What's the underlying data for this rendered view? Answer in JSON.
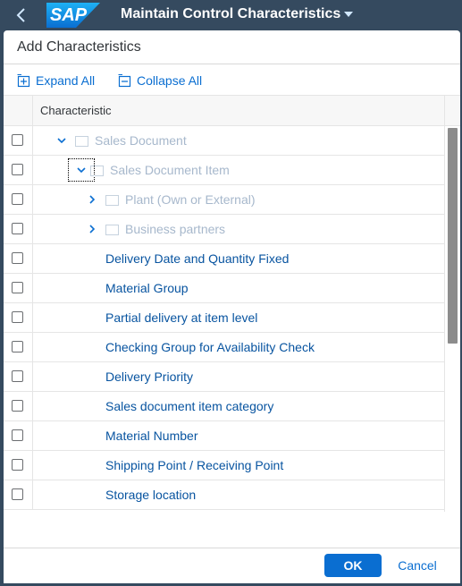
{
  "shell": {
    "logo_text": "SAP",
    "app_title": "Maintain Control Characteristics"
  },
  "dialog": {
    "title": "Add Characteristics",
    "toolbar": {
      "expand_all": "Expand All",
      "collapse_all": "Collapse All"
    },
    "table": {
      "column_header": "Characteristic",
      "rows": [
        {
          "label": "Sales Document",
          "level": 0,
          "expander": "expanded",
          "folder": true,
          "style": "dim"
        },
        {
          "label": "Sales Document Item",
          "level": 1,
          "expander": "expanded",
          "folder": true,
          "style": "dim",
          "focused": true
        },
        {
          "label": "Plant (Own or External)",
          "level": 2,
          "expander": "collapsed",
          "folder": true,
          "style": "dim"
        },
        {
          "label": "Business partners",
          "level": 2,
          "expander": "collapsed",
          "folder": true,
          "style": "dim"
        },
        {
          "label": "Delivery Date and Quantity Fixed",
          "level": 2,
          "expander": "none",
          "folder": false,
          "style": "link"
        },
        {
          "label": "Material Group",
          "level": 2,
          "expander": "none",
          "folder": false,
          "style": "link"
        },
        {
          "label": "Partial delivery at item level",
          "level": 2,
          "expander": "none",
          "folder": false,
          "style": "link"
        },
        {
          "label": "Checking Group for Availability Check",
          "level": 2,
          "expander": "none",
          "folder": false,
          "style": "link"
        },
        {
          "label": "Delivery Priority",
          "level": 2,
          "expander": "none",
          "folder": false,
          "style": "link"
        },
        {
          "label": "Sales document item category",
          "level": 2,
          "expander": "none",
          "folder": false,
          "style": "link"
        },
        {
          "label": "Material Number",
          "level": 2,
          "expander": "none",
          "folder": false,
          "style": "link"
        },
        {
          "label": "Shipping Point / Receiving Point",
          "level": 2,
          "expander": "none",
          "folder": false,
          "style": "link"
        },
        {
          "label": "Storage location",
          "level": 2,
          "expander": "none",
          "folder": false,
          "style": "link"
        }
      ]
    },
    "footer": {
      "ok_label": "OK",
      "cancel_label": "Cancel"
    }
  },
  "colors": {
    "shell_bg": "#354a5f",
    "accent": "#0a6ed1",
    "link": "#0854a0",
    "dim_text": "#a7b8cc"
  },
  "icons": [
    "back-icon",
    "chevron-down-icon",
    "expand-all-icon",
    "collapse-all-icon",
    "chevron-right-icon",
    "folder-icon"
  ]
}
